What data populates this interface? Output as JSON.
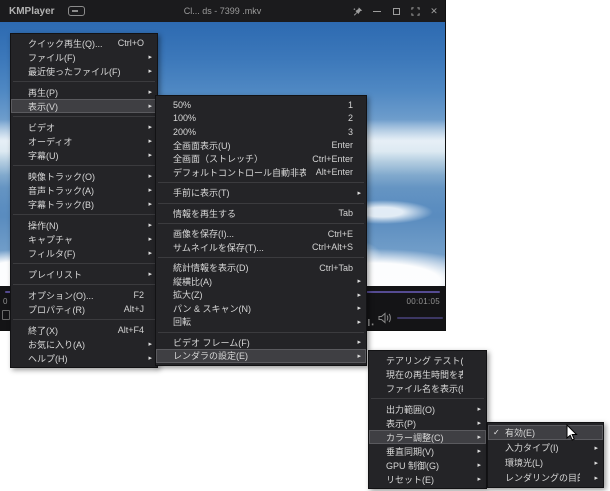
{
  "titlebar": {
    "app_name": "KMPlayer",
    "title": "Cl... ds - 7399 .mkv",
    "buttons": [
      {
        "name": "pin-button"
      },
      {
        "name": "minimize-button"
      },
      {
        "name": "restore-button"
      },
      {
        "name": "fullscreen-button"
      },
      {
        "name": "close-button",
        "glyph": "✕"
      }
    ]
  },
  "player": {
    "time_left_partial": "0",
    "time_right": "00:01:05",
    "colors": {
      "seek_bar": "#554b92",
      "volume_fill": "#7b66d6",
      "volume_track": "#3c3763",
      "titlebar_bg": "#1b1b1d",
      "menu_bg": "#242427",
      "menu_highlight": "#3f3f43"
    }
  },
  "menus": [
    {
      "name": "context-menu",
      "items": [
        {
          "label": "クイック再生(Q)...",
          "shortcut": "Ctrl+O"
        },
        {
          "label": "ファイル(F)",
          "submenu": true
        },
        {
          "label": "最近使ったファイル(F)",
          "submenu": true,
          "sep_after": true
        },
        {
          "label": "再生(P)",
          "submenu": true
        },
        {
          "label": "表示(V)",
          "submenu": true,
          "highlighted": true,
          "sep_after": true
        },
        {
          "label": "ビデオ",
          "submenu": true
        },
        {
          "label": "オーディオ",
          "submenu": true
        },
        {
          "label": "字幕(U)",
          "submenu": true,
          "sep_after": true
        },
        {
          "label": "映像トラック(O)",
          "submenu": true
        },
        {
          "label": "音声トラック(A)",
          "submenu": true
        },
        {
          "label": "字幕トラック(B)",
          "submenu": true,
          "sep_after": true
        },
        {
          "label": "操作(N)",
          "submenu": true
        },
        {
          "label": "キャプチャ",
          "submenu": true
        },
        {
          "label": "フィルタ(F)",
          "submenu": true,
          "sep_after": true
        },
        {
          "label": "プレイリスト",
          "submenu": true,
          "sep_after": true
        },
        {
          "label": "オプション(O)...",
          "shortcut": "F2"
        },
        {
          "label": "プロパティ(R)",
          "shortcut": "Alt+J",
          "sep_after": true
        },
        {
          "label": "終了(X)",
          "shortcut": "Alt+F4"
        },
        {
          "label": "お気に入り(A)",
          "submenu": true
        },
        {
          "label": "ヘルプ(H)",
          "submenu": true
        }
      ]
    },
    {
      "name": "view-submenu",
      "items": [
        {
          "label": "50%",
          "shortcut": "1"
        },
        {
          "label": "100%",
          "shortcut": "2"
        },
        {
          "label": "200%",
          "shortcut": "3"
        },
        {
          "label": "全画面表示(U)",
          "shortcut": "Enter"
        },
        {
          "label": "全画面（ストレッチ）",
          "shortcut": "Ctrl+Enter"
        },
        {
          "label": "デフォルトコントロール自動非表示モード",
          "shortcut": "Alt+Enter",
          "sep_after": true
        },
        {
          "label": "手前に表示(T)",
          "submenu": true,
          "sep_after": true
        },
        {
          "label": "情報を再生する",
          "shortcut": "Tab",
          "sep_after": true
        },
        {
          "label": "画像を保存(I)...",
          "shortcut": "Ctrl+E"
        },
        {
          "label": "サムネイルを保存(T)...",
          "shortcut": "Ctrl+Alt+S",
          "sep_after": true
        },
        {
          "label": "統計情報を表示(D)",
          "shortcut": "Ctrl+Tab"
        },
        {
          "label": "縦横比(A)",
          "submenu": true
        },
        {
          "label": "拡大(Z)",
          "submenu": true
        },
        {
          "label": "パン & スキャン(N)",
          "submenu": true
        },
        {
          "label": "回転",
          "submenu": true,
          "sep_after": true
        },
        {
          "label": "ビデオ フレーム(F)",
          "submenu": true
        },
        {
          "label": "レンダラの設定(E)",
          "submenu": true,
          "highlighted": true
        }
      ]
    },
    {
      "name": "renderer-settings-submenu",
      "items": [
        {
          "label": "テアリング テスト(T)"
        },
        {
          "label": "現在の再生時間を表示(I)"
        },
        {
          "label": "ファイル名を表示(F)",
          "sep_after": true
        },
        {
          "label": "出力範囲(O)",
          "submenu": true
        },
        {
          "label": "表示(P)",
          "submenu": true
        },
        {
          "label": "カラー調整(C)",
          "submenu": true,
          "highlighted": true
        },
        {
          "label": "垂直同期(V)",
          "submenu": true
        },
        {
          "label": "GPU 制御(G)",
          "submenu": true
        },
        {
          "label": "リセット(E)",
          "submenu": true
        }
      ]
    },
    {
      "name": "color-adjustment-submenu",
      "items": [
        {
          "label": "有効(E)",
          "checked": true,
          "highlighted": true
        },
        {
          "label": "入力タイプ(I)",
          "submenu": true
        },
        {
          "label": "環境光(L)",
          "submenu": true
        },
        {
          "label": "レンダリングの目的(R)",
          "submenu": true
        }
      ]
    }
  ],
  "glyphs": {
    "submenu_arrow": "▸",
    "check": "✓",
    "close": "✕"
  }
}
